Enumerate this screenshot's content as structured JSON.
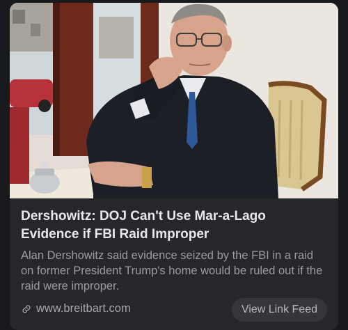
{
  "card": {
    "headline": "Dershowitz: DOJ Can't Use Mar-a-Lago Evidence if FBI Raid Improper",
    "summary": "Alan Dershowitz said evidence seized by the FBI in a raid on former President Trump's home would be ruled out if the raid were improper.",
    "source": "www.breitbart.com",
    "button_label": "View Link Feed",
    "source_icon": "link-icon",
    "thumbnail_description": "photo of a man in a suit seated at a table"
  },
  "colors": {
    "page_bg": "#18191c",
    "card_bg": "#26272b",
    "headline": "#e8e8ea",
    "summary": "#9b9ca1",
    "button_bg": "#35363b"
  }
}
